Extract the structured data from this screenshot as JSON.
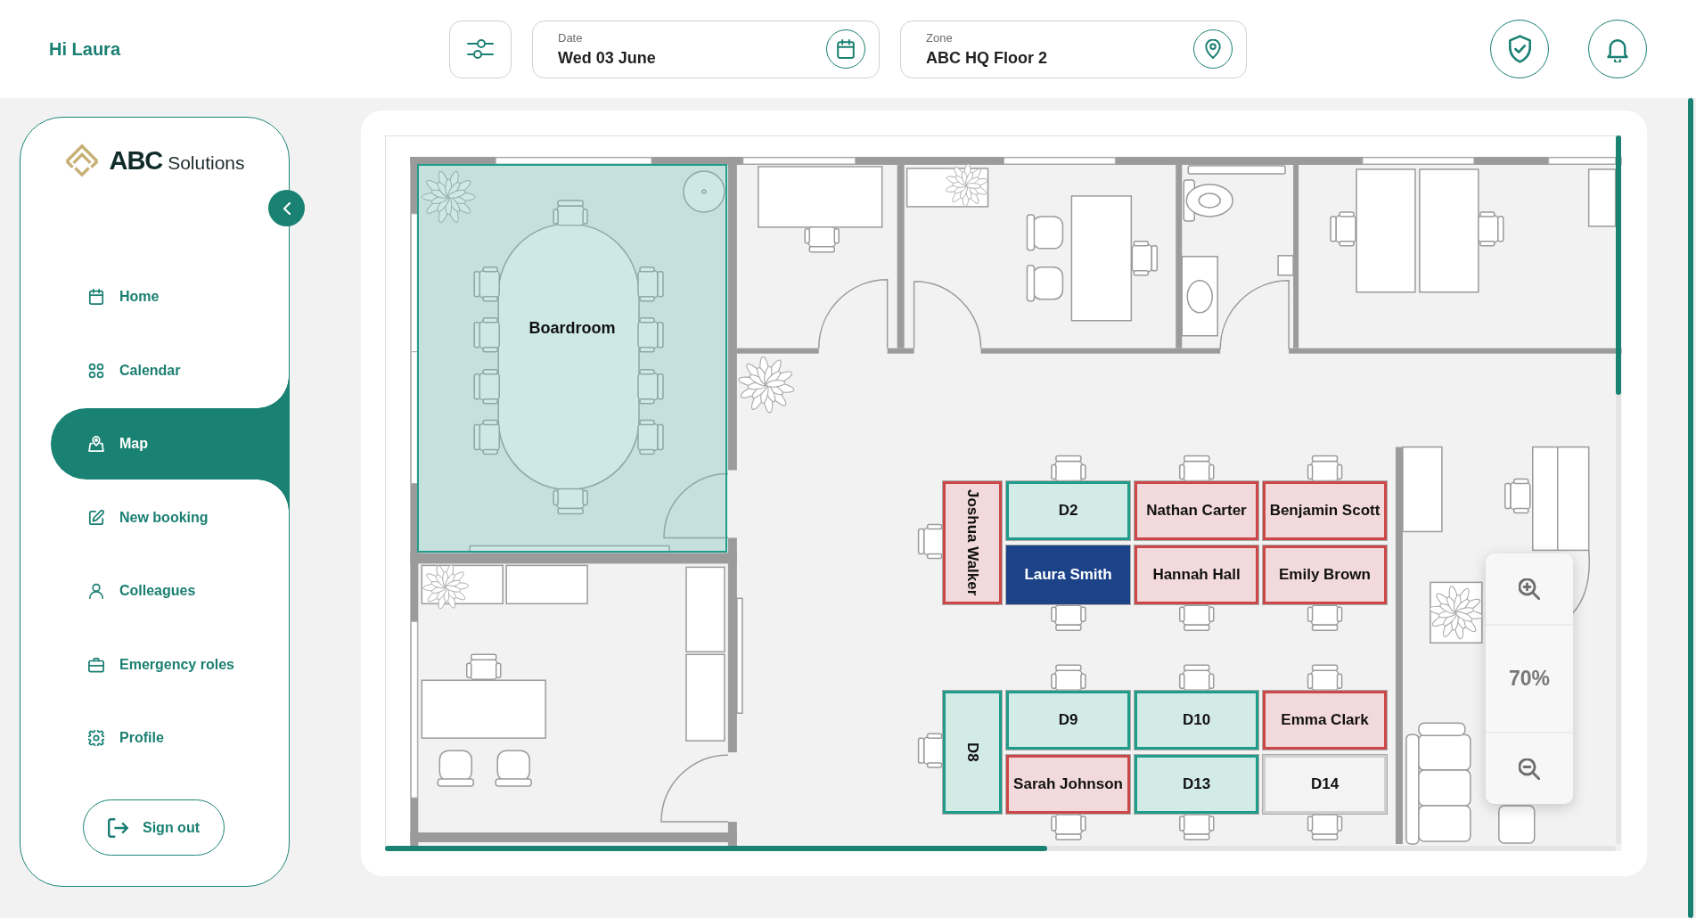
{
  "header": {
    "greeting": "Hi Laura",
    "date_field": {
      "label": "Date",
      "value": "Wed 03 June"
    },
    "zone_field": {
      "label": "Zone",
      "value": "ABC HQ Floor 2"
    }
  },
  "sidebar": {
    "brand": "**ABC** Solutions",
    "items": [
      {
        "label": "Home",
        "selected": false
      },
      {
        "label": "Calendar",
        "selected": false
      },
      {
        "label": "Map",
        "selected": true
      },
      {
        "label": "New booking",
        "selected": false
      },
      {
        "label": "Colleagues",
        "selected": false
      },
      {
        "label": "Emergency roles",
        "selected": false
      },
      {
        "label": "Profile",
        "selected": false
      }
    ],
    "sign_out": "Sign out"
  },
  "floor_plan": {
    "rooms": [
      {
        "label": "Boardroom",
        "booked": false
      }
    ],
    "desk_groups": [
      {
        "desks": [
          {
            "label": "Joshua Walker",
            "kind": "end",
            "booked": true,
            "selected": false,
            "disabled": false
          },
          {
            "label": "D2",
            "kind": "desk",
            "booked": false,
            "selected": false,
            "disabled": false
          },
          {
            "label": "Nathan Carter",
            "kind": "desk",
            "booked": true,
            "selected": false,
            "disabled": false
          },
          {
            "label": "Benjamin Scott",
            "kind": "desk",
            "booked": true,
            "selected": false,
            "disabled": false
          },
          {
            "label": "Laura Smith",
            "kind": "desk",
            "booked": false,
            "selected": true,
            "disabled": false
          },
          {
            "label": "Hannah Hall",
            "kind": "desk",
            "booked": true,
            "selected": false,
            "disabled": false
          },
          {
            "label": "Emily Brown",
            "kind": "desk",
            "booked": true,
            "selected": false,
            "disabled": false
          }
        ]
      },
      {
        "desks": [
          {
            "label": "D8",
            "kind": "end",
            "booked": false,
            "selected": false,
            "disabled": false
          },
          {
            "label": "D9",
            "kind": "desk",
            "booked": false,
            "selected": false,
            "disabled": false
          },
          {
            "label": "D10",
            "kind": "desk",
            "booked": false,
            "selected": false,
            "disabled": false
          },
          {
            "label": "Emma Clark",
            "kind": "desk",
            "booked": true,
            "selected": false,
            "disabled": false
          },
          {
            "label": "Sarah Johnson",
            "kind": "desk",
            "booked": true,
            "selected": false,
            "disabled": false
          },
          {
            "label": "D13",
            "kind": "desk",
            "booked": false,
            "selected": false,
            "disabled": false
          },
          {
            "label": "D14",
            "kind": "desk",
            "booked": false,
            "selected": false,
            "disabled": true
          }
        ]
      }
    ],
    "zoom_level": "70%"
  }
}
